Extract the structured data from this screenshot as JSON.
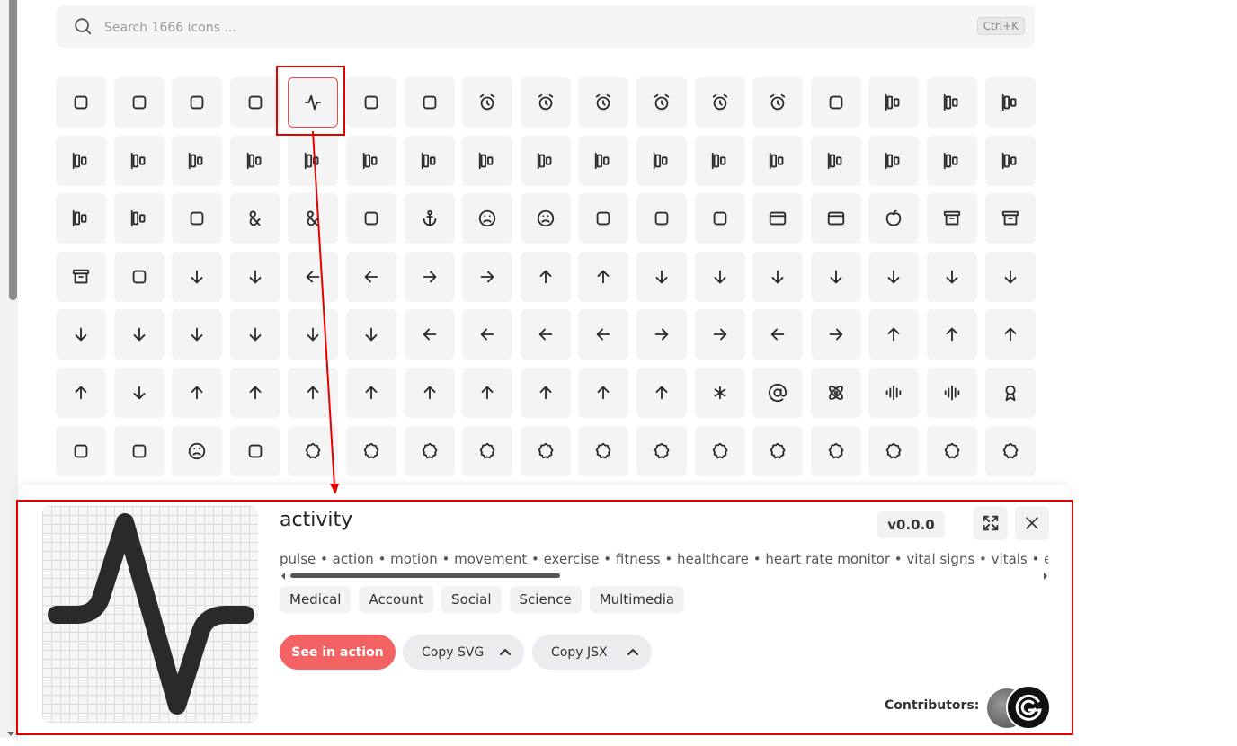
{
  "search": {
    "placeholder": "Search 1666 icons ...",
    "shortcut": "Ctrl+K"
  },
  "grid": {
    "icons": [
      "a-arrow-down-icon",
      "a-arrow-up-icon",
      "a-large-small-icon",
      "accessibility-icon",
      "activity-icon",
      "air-vent-icon",
      "airplay-icon",
      "alarm-clock-icon",
      "alarm-clock-check-icon",
      "alarm-clock-minus-icon",
      "alarm-clock-off-icon",
      "alarm-clock-plus-icon",
      "alarm-smoke-icon",
      "album-icon",
      "align-center-horizontal-icon",
      "align-center-vertical-icon",
      "align-end-horizontal-icon",
      "align-end-vertical-icon",
      "align-horizontal-distribute-center-icon",
      "align-horizontal-distribute-end-icon",
      "align-horizontal-distribute-start-icon",
      "align-horizontal-justify-center-icon",
      "align-horizontal-justify-end-icon",
      "align-horizontal-justify-start-icon",
      "align-horizontal-space-around-icon",
      "align-horizontal-space-between-icon",
      "align-start-horizontal-icon",
      "align-start-vertical-icon",
      "align-vertical-distribute-center-icon",
      "align-vertical-distribute-end-icon",
      "align-vertical-distribute-start-icon",
      "align-vertical-justify-center-icon",
      "align-vertical-justify-end-icon",
      "align-vertical-justify-start-icon",
      "align-vertical-space-around-icon",
      "align-vertical-space-between-icon",
      "ambulance-icon",
      "ampersand-icon",
      "ampersands-icon",
      "amphora-icon",
      "anchor-icon",
      "angry-icon",
      "annoyed-icon",
      "antenna-icon",
      "anvil-icon",
      "aperture-icon",
      "app-window-icon",
      "app-window-mac-icon",
      "apple-icon",
      "archive-icon",
      "archive-restore-icon",
      "archive-x-icon",
      "armchair-icon",
      "arrow-big-down-icon",
      "arrow-big-down-dash-icon",
      "arrow-big-left-icon",
      "arrow-big-left-dash-icon",
      "arrow-big-right-icon",
      "arrow-big-right-dash-icon",
      "arrow-big-up-icon",
      "arrow-big-up-dash-icon",
      "arrow-down-icon",
      "arrow-down-0-1-icon",
      "arrow-down-1-0-icon",
      "arrow-down-a-z-icon",
      "arrow-down-from-line-icon",
      "arrow-down-left-icon",
      "arrow-down-narrow-wide-icon",
      "arrow-down-right-icon",
      "arrow-down-to-dot-icon",
      "arrow-down-to-line-icon",
      "arrow-down-up-icon",
      "arrow-down-wide-narrow-icon",
      "arrow-down-z-a-icon",
      "arrow-left-icon",
      "arrow-left-from-line-icon",
      "arrow-left-right-icon",
      "arrow-left-to-line-icon",
      "arrow-right-icon",
      "arrow-right-from-line-icon",
      "arrow-right-left-icon",
      "arrow-right-to-line-icon",
      "arrow-up-icon",
      "arrow-up-0-1-icon",
      "arrow-up-1-0-icon",
      "arrow-up-a-z-icon",
      "arrow-up-down-icon",
      "arrow-up-from-dot-icon",
      "arrow-up-from-line-icon",
      "arrow-up-left-icon",
      "arrow-up-narrow-wide-icon",
      "arrow-up-right-icon",
      "arrow-up-to-line-icon",
      "arrow-up-wide-narrow-icon",
      "arrow-up-z-a-icon",
      "arrows-up-from-line-icon",
      "asterisk-icon",
      "at-sign-icon",
      "atom-icon",
      "audio-lines-icon",
      "audio-waveform-icon",
      "award-icon",
      "axe-icon",
      "axis-3d-icon",
      "baby-icon",
      "backpack-icon",
      "badge-icon",
      "badge-alert-icon",
      "badge-cent-icon",
      "badge-check-icon",
      "badge-dollar-sign-icon",
      "badge-euro-icon",
      "badge-indian-rupee-icon",
      "badge-info-icon",
      "badge-japanese-yen-icon",
      "badge-minus-icon",
      "badge-percent-icon",
      "badge-plus-icon",
      "badge-pound-sterling-icon"
    ]
  },
  "detail": {
    "name": "activity",
    "version": "v0.0.0",
    "tags": "pulse • action • motion • movement • exercise • fitness • healthcare • heart rate monitor • vital signs • vitals • emergency • doctor • cardiology",
    "categories": [
      "Medical",
      "Account",
      "Social",
      "Science",
      "Multimedia"
    ],
    "see_in_action": "See in action",
    "copy_svg": "Copy SVG",
    "copy_jsx": "Copy JSX",
    "contributors_label": "Contributors:"
  },
  "colors": {
    "accent": "#f46363",
    "highlight": "#e50000"
  }
}
